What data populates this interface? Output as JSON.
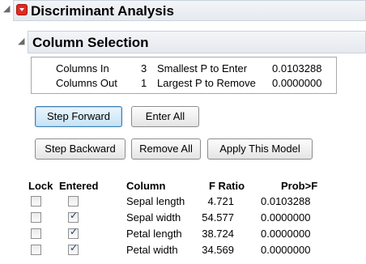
{
  "report": {
    "title": "Discriminant Analysis",
    "section_title": "Column Selection"
  },
  "summary": {
    "columns_in_label": "Columns In",
    "columns_in_value": "3",
    "columns_out_label": "Columns Out",
    "columns_out_value": "1",
    "smallest_p_label": "Smallest P to Enter",
    "smallest_p_value": "0.0103288",
    "largest_p_label": "Largest P to Remove",
    "largest_p_value": "0.0000000"
  },
  "buttons": {
    "step_forward": "Step Forward",
    "enter_all": "Enter All",
    "step_backward": "Step Backward",
    "remove_all": "Remove All",
    "apply_model": "Apply This Model"
  },
  "table": {
    "headers": {
      "lock": "Lock",
      "entered": "Entered",
      "column": "Column",
      "f_ratio": "F Ratio",
      "prob": "Prob>F"
    },
    "rows": [
      {
        "lock": false,
        "entered": false,
        "column": "Sepal length",
        "f_ratio": "4.721",
        "prob": "0.0103288"
      },
      {
        "lock": false,
        "entered": true,
        "column": "Sepal width",
        "f_ratio": "54.577",
        "prob": "0.0000000"
      },
      {
        "lock": false,
        "entered": true,
        "column": "Petal length",
        "f_ratio": "38.724",
        "prob": "0.0000000"
      },
      {
        "lock": false,
        "entered": true,
        "column": "Petal width",
        "f_ratio": "34.569",
        "prob": "0.0000000"
      }
    ]
  },
  "colors": {
    "menu_red": "#e02a20",
    "header_bar": "#e5e9ee",
    "default_button": "#c6e2f5",
    "check": "#1d3f7a"
  }
}
